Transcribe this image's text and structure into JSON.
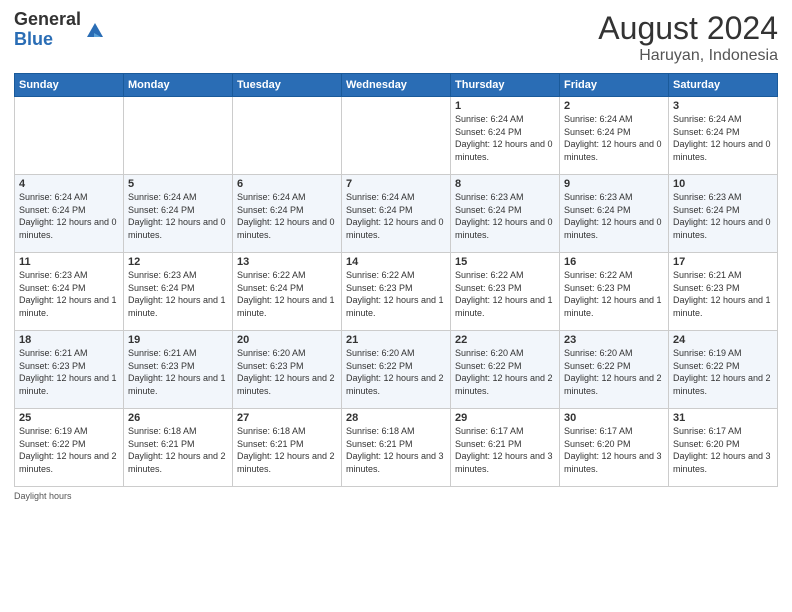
{
  "header": {
    "logo_general": "General",
    "logo_blue": "Blue",
    "month_year": "August 2024",
    "location": "Haruyan, Indonesia"
  },
  "weekdays": [
    "Sunday",
    "Monday",
    "Tuesday",
    "Wednesday",
    "Thursday",
    "Friday",
    "Saturday"
  ],
  "weeks": [
    [
      {
        "day": "",
        "sunrise": "",
        "sunset": "",
        "daylight": "",
        "empty": true
      },
      {
        "day": "",
        "sunrise": "",
        "sunset": "",
        "daylight": "",
        "empty": true
      },
      {
        "day": "",
        "sunrise": "",
        "sunset": "",
        "daylight": "",
        "empty": true
      },
      {
        "day": "",
        "sunrise": "",
        "sunset": "",
        "daylight": "",
        "empty": true
      },
      {
        "day": "1",
        "sunrise": "Sunrise: 6:24 AM",
        "sunset": "Sunset: 6:24 PM",
        "daylight": "Daylight: 12 hours and 0 minutes.",
        "empty": false
      },
      {
        "day": "2",
        "sunrise": "Sunrise: 6:24 AM",
        "sunset": "Sunset: 6:24 PM",
        "daylight": "Daylight: 12 hours and 0 minutes.",
        "empty": false
      },
      {
        "day": "3",
        "sunrise": "Sunrise: 6:24 AM",
        "sunset": "Sunset: 6:24 PM",
        "daylight": "Daylight: 12 hours and 0 minutes.",
        "empty": false
      }
    ],
    [
      {
        "day": "4",
        "sunrise": "Sunrise: 6:24 AM",
        "sunset": "Sunset: 6:24 PM",
        "daylight": "Daylight: 12 hours and 0 minutes.",
        "empty": false
      },
      {
        "day": "5",
        "sunrise": "Sunrise: 6:24 AM",
        "sunset": "Sunset: 6:24 PM",
        "daylight": "Daylight: 12 hours and 0 minutes.",
        "empty": false
      },
      {
        "day": "6",
        "sunrise": "Sunrise: 6:24 AM",
        "sunset": "Sunset: 6:24 PM",
        "daylight": "Daylight: 12 hours and 0 minutes.",
        "empty": false
      },
      {
        "day": "7",
        "sunrise": "Sunrise: 6:24 AM",
        "sunset": "Sunset: 6:24 PM",
        "daylight": "Daylight: 12 hours and 0 minutes.",
        "empty": false
      },
      {
        "day": "8",
        "sunrise": "Sunrise: 6:23 AM",
        "sunset": "Sunset: 6:24 PM",
        "daylight": "Daylight: 12 hours and 0 minutes.",
        "empty": false
      },
      {
        "day": "9",
        "sunrise": "Sunrise: 6:23 AM",
        "sunset": "Sunset: 6:24 PM",
        "daylight": "Daylight: 12 hours and 0 minutes.",
        "empty": false
      },
      {
        "day": "10",
        "sunrise": "Sunrise: 6:23 AM",
        "sunset": "Sunset: 6:24 PM",
        "daylight": "Daylight: 12 hours and 0 minutes.",
        "empty": false
      }
    ],
    [
      {
        "day": "11",
        "sunrise": "Sunrise: 6:23 AM",
        "sunset": "Sunset: 6:24 PM",
        "daylight": "Daylight: 12 hours and 1 minute.",
        "empty": false
      },
      {
        "day": "12",
        "sunrise": "Sunrise: 6:23 AM",
        "sunset": "Sunset: 6:24 PM",
        "daylight": "Daylight: 12 hours and 1 minute.",
        "empty": false
      },
      {
        "day": "13",
        "sunrise": "Sunrise: 6:22 AM",
        "sunset": "Sunset: 6:24 PM",
        "daylight": "Daylight: 12 hours and 1 minute.",
        "empty": false
      },
      {
        "day": "14",
        "sunrise": "Sunrise: 6:22 AM",
        "sunset": "Sunset: 6:23 PM",
        "daylight": "Daylight: 12 hours and 1 minute.",
        "empty": false
      },
      {
        "day": "15",
        "sunrise": "Sunrise: 6:22 AM",
        "sunset": "Sunset: 6:23 PM",
        "daylight": "Daylight: 12 hours and 1 minute.",
        "empty": false
      },
      {
        "day": "16",
        "sunrise": "Sunrise: 6:22 AM",
        "sunset": "Sunset: 6:23 PM",
        "daylight": "Daylight: 12 hours and 1 minute.",
        "empty": false
      },
      {
        "day": "17",
        "sunrise": "Sunrise: 6:21 AM",
        "sunset": "Sunset: 6:23 PM",
        "daylight": "Daylight: 12 hours and 1 minute.",
        "empty": false
      }
    ],
    [
      {
        "day": "18",
        "sunrise": "Sunrise: 6:21 AM",
        "sunset": "Sunset: 6:23 PM",
        "daylight": "Daylight: 12 hours and 1 minute.",
        "empty": false
      },
      {
        "day": "19",
        "sunrise": "Sunrise: 6:21 AM",
        "sunset": "Sunset: 6:23 PM",
        "daylight": "Daylight: 12 hours and 1 minute.",
        "empty": false
      },
      {
        "day": "20",
        "sunrise": "Sunrise: 6:20 AM",
        "sunset": "Sunset: 6:23 PM",
        "daylight": "Daylight: 12 hours and 2 minutes.",
        "empty": false
      },
      {
        "day": "21",
        "sunrise": "Sunrise: 6:20 AM",
        "sunset": "Sunset: 6:22 PM",
        "daylight": "Daylight: 12 hours and 2 minutes.",
        "empty": false
      },
      {
        "day": "22",
        "sunrise": "Sunrise: 6:20 AM",
        "sunset": "Sunset: 6:22 PM",
        "daylight": "Daylight: 12 hours and 2 minutes.",
        "empty": false
      },
      {
        "day": "23",
        "sunrise": "Sunrise: 6:20 AM",
        "sunset": "Sunset: 6:22 PM",
        "daylight": "Daylight: 12 hours and 2 minutes.",
        "empty": false
      },
      {
        "day": "24",
        "sunrise": "Sunrise: 6:19 AM",
        "sunset": "Sunset: 6:22 PM",
        "daylight": "Daylight: 12 hours and 2 minutes.",
        "empty": false
      }
    ],
    [
      {
        "day": "25",
        "sunrise": "Sunrise: 6:19 AM",
        "sunset": "Sunset: 6:22 PM",
        "daylight": "Daylight: 12 hours and 2 minutes.",
        "empty": false
      },
      {
        "day": "26",
        "sunrise": "Sunrise: 6:18 AM",
        "sunset": "Sunset: 6:21 PM",
        "daylight": "Daylight: 12 hours and 2 minutes.",
        "empty": false
      },
      {
        "day": "27",
        "sunrise": "Sunrise: 6:18 AM",
        "sunset": "Sunset: 6:21 PM",
        "daylight": "Daylight: 12 hours and 2 minutes.",
        "empty": false
      },
      {
        "day": "28",
        "sunrise": "Sunrise: 6:18 AM",
        "sunset": "Sunset: 6:21 PM",
        "daylight": "Daylight: 12 hours and 3 minutes.",
        "empty": false
      },
      {
        "day": "29",
        "sunrise": "Sunrise: 6:17 AM",
        "sunset": "Sunset: 6:21 PM",
        "daylight": "Daylight: 12 hours and 3 minutes.",
        "empty": false
      },
      {
        "day": "30",
        "sunrise": "Sunrise: 6:17 AM",
        "sunset": "Sunset: 6:20 PM",
        "daylight": "Daylight: 12 hours and 3 minutes.",
        "empty": false
      },
      {
        "day": "31",
        "sunrise": "Sunrise: 6:17 AM",
        "sunset": "Sunset: 6:20 PM",
        "daylight": "Daylight: 12 hours and 3 minutes.",
        "empty": false
      }
    ]
  ],
  "footer": {
    "daylight_label": "Daylight hours"
  }
}
